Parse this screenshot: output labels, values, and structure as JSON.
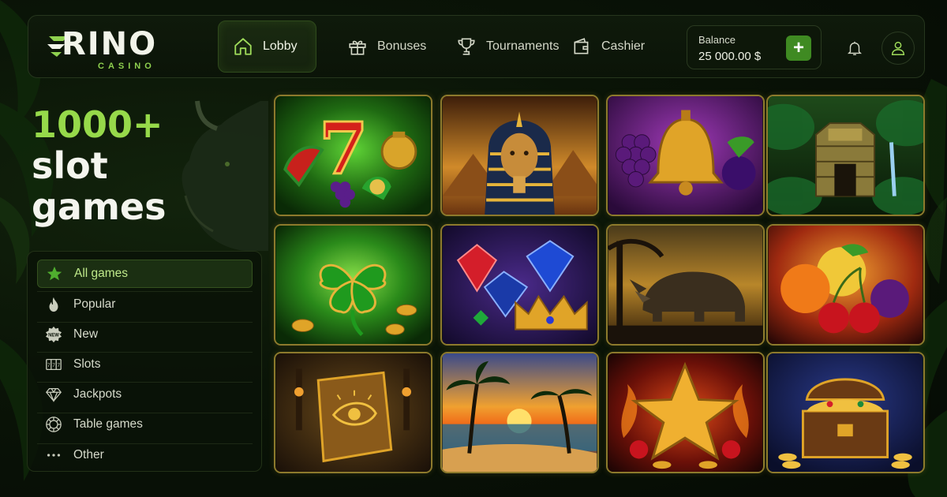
{
  "brand": {
    "name": "RINO",
    "sub": "CASINO",
    "accent": "#8fd14f"
  },
  "nav": {
    "items": [
      {
        "label": "Lobby",
        "icon": "home-icon",
        "active": true
      },
      {
        "label": "Bonuses",
        "icon": "gift-icon",
        "active": false
      },
      {
        "label": "Tournaments",
        "icon": "trophy-icon",
        "active": false
      },
      {
        "label": "Cashier",
        "icon": "wallet-icon",
        "active": false
      }
    ]
  },
  "balance": {
    "label": "Balance",
    "value": "25 000.00 $",
    "add_symbol": "+"
  },
  "header_icons": [
    "bell-icon",
    "user-icon"
  ],
  "hero": {
    "line1": "1000+",
    "line2": "slot",
    "line3": "games"
  },
  "categories": [
    {
      "label": "All games",
      "icon": "star-icon",
      "active": true
    },
    {
      "label": "Popular",
      "icon": "flame-icon",
      "active": false
    },
    {
      "label": "New",
      "icon": "new-badge-icon",
      "active": false
    },
    {
      "label": "Slots",
      "icon": "slot-machine-icon",
      "active": false
    },
    {
      "label": "Jackpots",
      "icon": "diamond-icon",
      "active": false
    },
    {
      "label": "Table games",
      "icon": "casino-chip-icon",
      "active": false
    },
    {
      "label": "Other",
      "icon": "more-dots-icon",
      "active": false
    }
  ],
  "new_badge_text": "NEW",
  "games": [
    {
      "theme": "fruit-seven-bell",
      "icon": "lucky-seven-icon"
    },
    {
      "theme": "pharaoh-egypt",
      "icon": "pharaoh-icon"
    },
    {
      "theme": "golden-bell-grapes",
      "icon": "bell-icon"
    },
    {
      "theme": "jungle-temple",
      "icon": "temple-icon"
    },
    {
      "theme": "four-leaf-clover",
      "icon": "clover-icon"
    },
    {
      "theme": "gems-crown",
      "icon": "gem-icon"
    },
    {
      "theme": "rhino-savanna",
      "icon": "rhino-icon"
    },
    {
      "theme": "fruits-cherries",
      "icon": "fruit-icon"
    },
    {
      "theme": "book-of-eye",
      "icon": "book-icon"
    },
    {
      "theme": "tropical-sunset",
      "icon": "palm-icon"
    },
    {
      "theme": "golden-star-fire",
      "icon": "star-icon"
    },
    {
      "theme": "treasure-chest",
      "icon": "chest-icon"
    }
  ]
}
